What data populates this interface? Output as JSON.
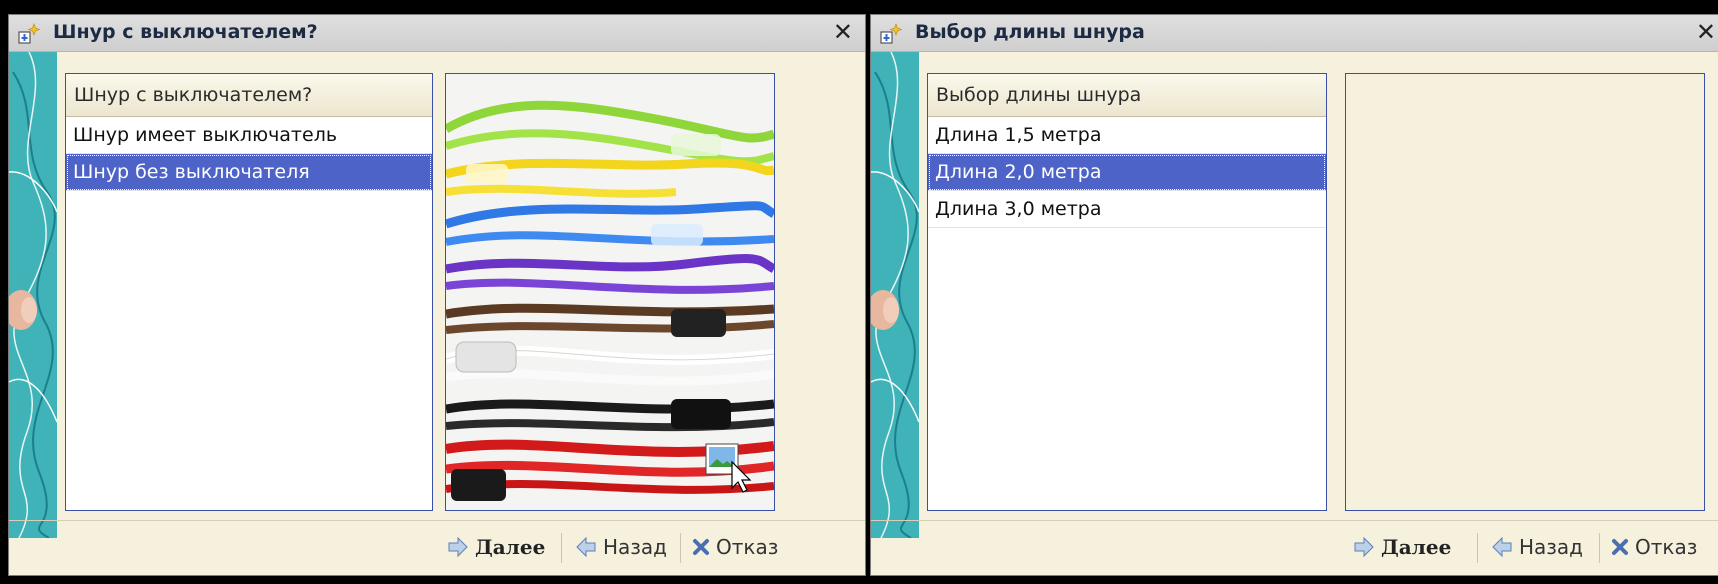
{
  "dialogs": [
    {
      "title": "Шнур с выключателем?",
      "list_header": "Шнур с выключателем?",
      "items": [
        "Шнур имеет выключатель",
        "Шнур без выключателя"
      ],
      "selected_item": "Шнур без выключателя",
      "buttons": {
        "next": "Далее",
        "back": "Назад",
        "cancel": "Отказ"
      }
    },
    {
      "title": "Выбор длины шнура",
      "list_header": "Выбор длины шнура",
      "items": [
        "Длина 1,5 метра",
        "Длина 2,0 метра",
        "Длина 3,0 метра"
      ],
      "selected_item": "Длина 2,0 метра",
      "buttons": {
        "next": "Далее",
        "back": "Назад",
        "cancel": "Отказ"
      }
    }
  ],
  "icons": {
    "title": "wizard-icon",
    "close": "close-icon",
    "next": "arrow-right-icon",
    "back": "arrow-left-icon",
    "cancel": "cancel-x-icon",
    "image_cursor": "image-drag-cursor-icon"
  },
  "colors": {
    "selection": "#4e63c8",
    "panel_bg": "#f6f1dd",
    "list_border": "#3a4fa8",
    "side_strip": "#3fb3b8"
  }
}
